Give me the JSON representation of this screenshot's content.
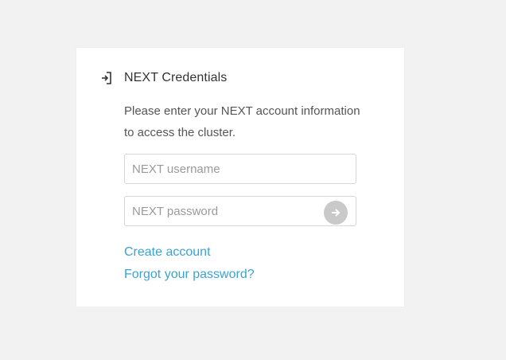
{
  "login": {
    "title": "NEXT Credentials",
    "description": "Please enter your NEXT account information to access the cluster.",
    "username_placeholder": "NEXT username",
    "password_placeholder": "NEXT password",
    "create_account_label": "Create account",
    "forgot_password_label": "Forgot your password?",
    "icons": {
      "header": "login-icon",
      "submit": "arrow-right-circle-icon"
    }
  },
  "colors": {
    "page_background": "#f2f2f2",
    "card_background": "#ffffff",
    "link": "#3ba3d0",
    "submit_button": "#c9c9c9"
  }
}
